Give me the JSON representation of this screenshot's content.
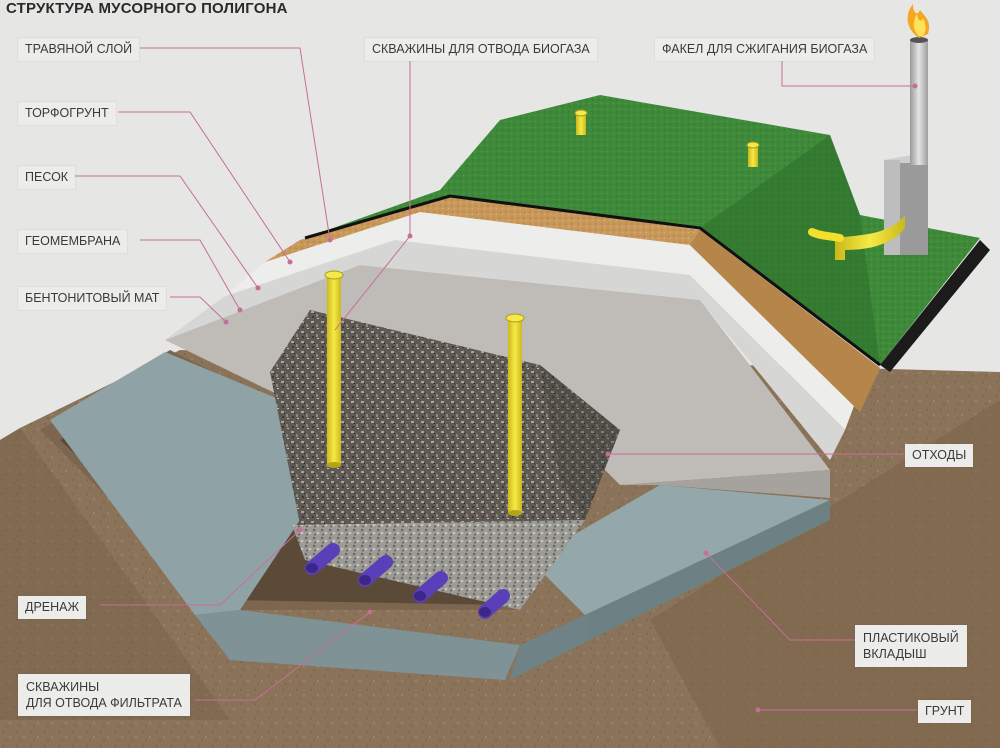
{
  "title": "СТРУКТУРА МУСОРНОГО ПОЛИГОНА",
  "colors": {
    "grass": "#3f8a3a",
    "grass_side": "#2f6f2c",
    "peat": "#c9995a",
    "sand": "#ededed",
    "geomembrane": "#d2d2d2",
    "bentonite": "#c6c2bf",
    "waste": "#6e6a63",
    "drainage": "#b9b7b0",
    "liner": "#93a7aa",
    "soil": "#8a7258",
    "pipe_yellow": "#f2e02c",
    "pipe_purple": "#5a3fb8",
    "leader": "#c86d9a"
  },
  "labels": {
    "grass_layer": "ТРАВЯНОЙ СЛОЙ",
    "peat_soil": "ТОРФОГРУНТ",
    "sand": "ПЕСОК",
    "geomembrane": "ГЕОМЕМБРАНА",
    "bentonite_mat": "БЕНТОНИТОВЫЙ МАТ",
    "gas_wells": "СКВАЖИНЫ ДЛЯ ОТВОДА БИОГАЗА",
    "flare": "ФАКЕЛ ДЛЯ СЖИГАНИЯ БИОГАЗА",
    "waste": "ОТХОДЫ",
    "drainage": "ДРЕНАЖ",
    "plastic_liner_1": "ПЛАСТИКОВЫЙ",
    "plastic_liner_2": "ВКЛАДЫШ",
    "leachate_wells_1": "СКВАЖИНЫ",
    "leachate_wells_2": "ДЛЯ ОТВОДА ФИЛЬТРАТА",
    "ground": "ГРУНТ"
  }
}
